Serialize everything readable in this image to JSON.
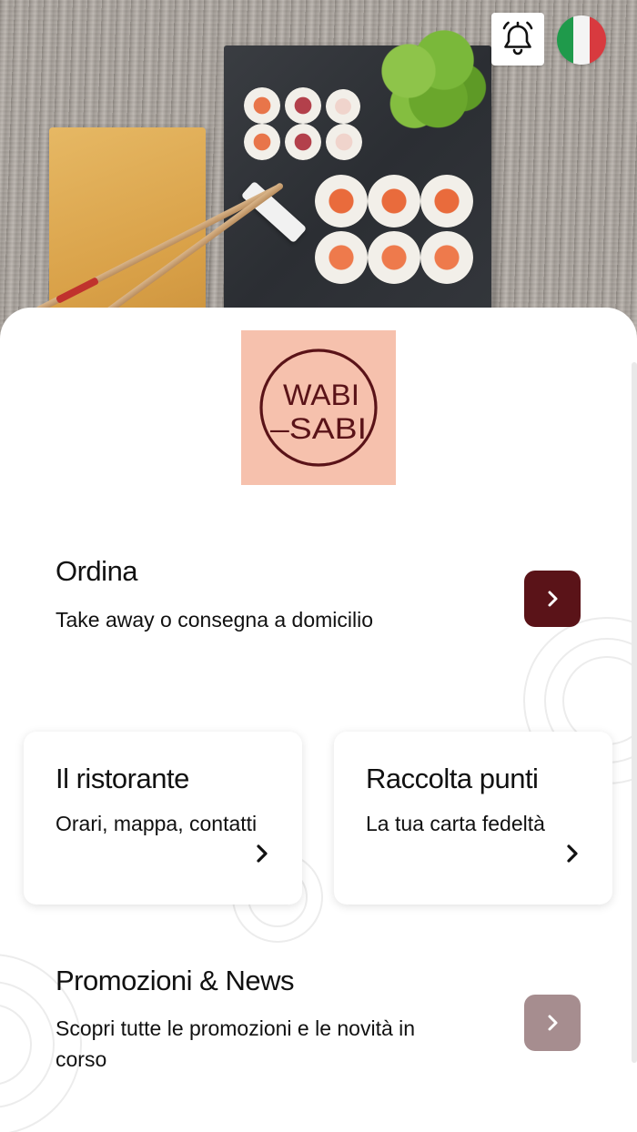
{
  "hero": {
    "notification_icon": "bell-icon",
    "language_icon": "italy-flag-icon",
    "flag_colors": [
      "#009246",
      "#ffffff",
      "#ce2b37"
    ]
  },
  "logo": {
    "line1": "WABI",
    "line2": "–SABI",
    "background": "#f6c1ad",
    "ink": "#5a1318"
  },
  "order": {
    "title": "Ordina",
    "subtitle": "Take away o consegna a domicilio",
    "button_icon": "chevron-right-icon",
    "button_color": "#5a1318"
  },
  "restaurant": {
    "title": "Il ristorante",
    "subtitle": "Orari, mappa, contatti",
    "icon": "chevron-right-icon"
  },
  "loyalty": {
    "title": "Raccolta punti",
    "subtitle": "La tua carta fedeltà",
    "icon": "chevron-right-icon"
  },
  "promotions": {
    "title": "Promozioni & News",
    "subtitle": "Scopri tutte le promozioni e le novità in corso",
    "button_icon": "chevron-right-icon",
    "button_color": "#a68d8f"
  }
}
